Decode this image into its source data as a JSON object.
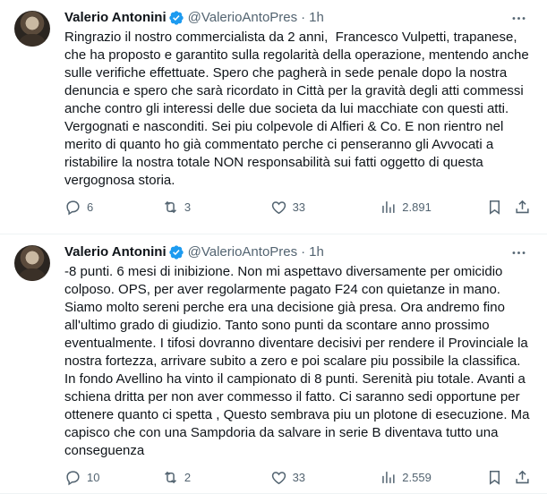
{
  "tweets": [
    {
      "author": "Valerio Antonini",
      "handle": "@ValerioAntoPres",
      "separator": "·",
      "time": "1h",
      "text": "Ringrazio il nostro commercialista da 2 anni,  Francesco Vulpetti, trapanese, che ha proposto e garantito sulla regolarità della operazione, mentendo anche sulle verifiche effettuate. Spero che pagherà in sede penale dopo la nostra denuncia e spero che sarà ricordato in Città per la gravità degli atti commessi anche contro gli interessi delle due societa da lui macchiate con questi atti.  Vergognati e nasconditi. Sei piu colpevole di Alfieri & Co. E non rientro nel merito di quanto ho già commentato perche ci penseranno gli Avvocati a ristabilire la nostra totale NON responsabilità sui fatti oggetto di questa vergognosa storia.",
      "replies": "6",
      "reposts": "3",
      "likes": "33",
      "views": "2.891"
    },
    {
      "author": "Valerio Antonini",
      "handle": "@ValerioAntoPres",
      "separator": "·",
      "time": "1h",
      "text": "-8 punti. 6 mesi di inibizione. Non mi aspettavo diversamente per omicidio colposo. OPS, per aver regolarmente pagato F24 con quietanze in mano. Siamo molto sereni perche era una decisione già presa. Ora andremo fino all'ultimo grado di giudizio. Tanto sono punti da scontare anno prossimo eventualmente. I tifosi dovranno diventare decisivi per rendere il Provinciale la nostra fortezza, arrivare subito a zero e poi scalare piu possibile la classifica. In fondo Avellino ha vinto il campionato di 8 punti. Serenità piu totale. Avanti a schiena dritta per non aver commesso il fatto. Ci saranno sedi opportune per ottenere quanto ci spetta , Questo sembrava piu un plotone di esecuzione. Ma capisco che con una Sampdoria da salvare in serie B diventava tutto una conseguenza",
      "replies": "10",
      "reposts": "2",
      "likes": "33",
      "views": "2.559"
    }
  ],
  "icons": {
    "verified": "verified-badge-icon",
    "more": "more-icon",
    "reply": "reply-icon",
    "repost": "repost-icon",
    "like": "like-icon",
    "views": "views-icon",
    "bookmark": "bookmark-icon",
    "share": "share-icon"
  },
  "colors": {
    "verified": "#1d9bf0",
    "secondary_text": "#536471",
    "primary_text": "#0f1419",
    "divider": "#eff3f4"
  }
}
